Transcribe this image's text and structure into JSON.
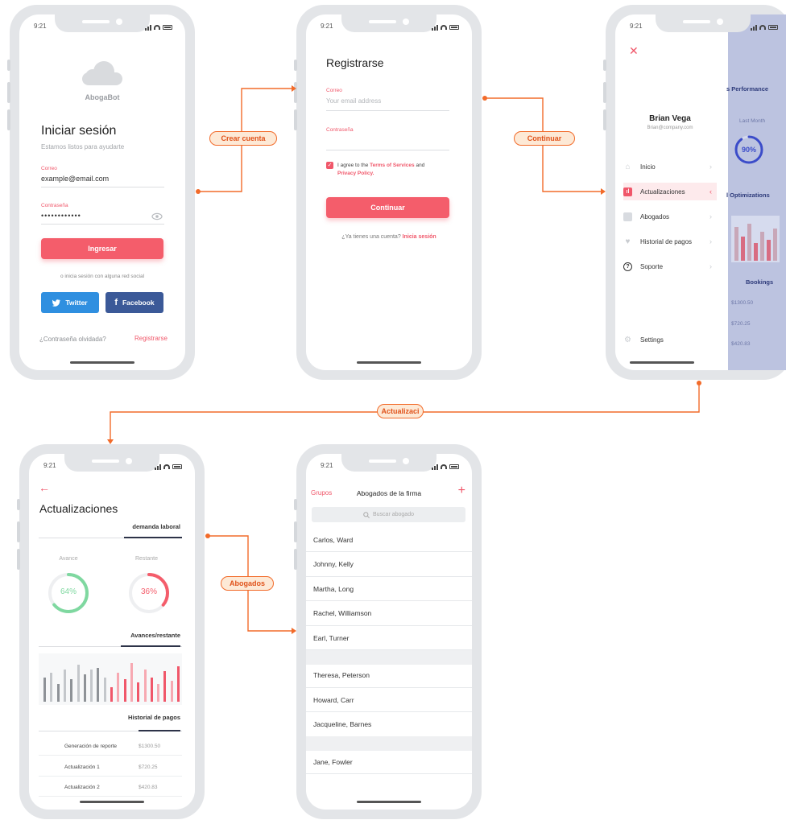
{
  "status_time": "9:21",
  "colors": {
    "accent": "#f45d6b",
    "flow": "#f26b2a",
    "twitter": "#2f8fe0",
    "facebook": "#3b5998",
    "progress_green": "#7fd8a0",
    "progress_blue": "#3b4cc9"
  },
  "flow_labels": {
    "crear_cuenta": "Crear cuenta",
    "continuar": "Continuar",
    "actualizaciones": "Actualizaci",
    "abogados": "Abogados"
  },
  "login": {
    "brand": "AbogaBot",
    "title": "Iniciar sesión",
    "subtitle": "Estamos listos para ayudarte",
    "email_label": "Correo",
    "email_value": "example@email.com",
    "password_label": "Contraseña",
    "password_value": "••••••••••••",
    "submit": "Ingresar",
    "social_hint": "o inicia sesión con alguna red social",
    "twitter": "Twitter",
    "facebook": "Facebook",
    "forgot": "¿Contraseña olvidada?",
    "register": "Registrarse"
  },
  "register": {
    "title": "Registrarse",
    "email_label": "Correo",
    "email_placeholder": "Your email address",
    "password_label": "Contraseña",
    "terms_prefix": "I agree to the",
    "terms_link": "Terms of Services",
    "terms_and": "and",
    "privacy_link": "Privacy Policy.",
    "submit": "Continuar",
    "has_account": "¿Ya tienes una cuenta?",
    "login_link": "Inicia sesión"
  },
  "menu": {
    "user_name": "Brian Vega",
    "user_email": "Brian@company.com",
    "items": [
      {
        "label": "Inicio",
        "icon": "home-icon"
      },
      {
        "label": "Actualizaciones",
        "icon": "chart-icon"
      },
      {
        "label": "Abogados",
        "icon": "contacts-icon"
      },
      {
        "label": "Historial de pagos",
        "icon": "heart-icon"
      },
      {
        "label": "Soporte",
        "icon": "help-icon"
      }
    ],
    "settings": "Settings",
    "overlay": {
      "performance": "s Performance",
      "last_month": "Last Month",
      "ring_value": "90%",
      "optimizations": "l Optimizations",
      "bookings": "Bookings",
      "amounts": [
        "$1300.50",
        "$720.25",
        "$420.83"
      ]
    }
  },
  "updates": {
    "title": "Actualizaciones",
    "tab_demand": "demanda laboral",
    "avance_label": "Avance",
    "restante_label": "Restante",
    "avance_value": "64%",
    "restante_value": "36%",
    "avance_fraction": 0.64,
    "restante_fraction": 0.36,
    "tab_progress": "Avances/restante",
    "tab_payments": "Historial de pagos",
    "payments": [
      {
        "name": "Generación de reporte",
        "amount": "$1300.50"
      },
      {
        "name": "Actualización 1",
        "amount": "$720.25"
      },
      {
        "name": "Actualización 2",
        "amount": "$420.83"
      }
    ]
  },
  "lawyers": {
    "back": "Grupos",
    "title": "Abogados de la firma",
    "search_placeholder": "Buscar abogado",
    "group1": [
      "Carlos, Ward",
      "Johnny, Kelly",
      "Martha, Long",
      "Rachel, Williamson",
      "Earl, Turner"
    ],
    "group2": [
      "Theresa, Peterson",
      "Howard, Carr",
      "Jacqueline, Barnes"
    ],
    "group3": [
      "Jane, Fowler"
    ]
  }
}
